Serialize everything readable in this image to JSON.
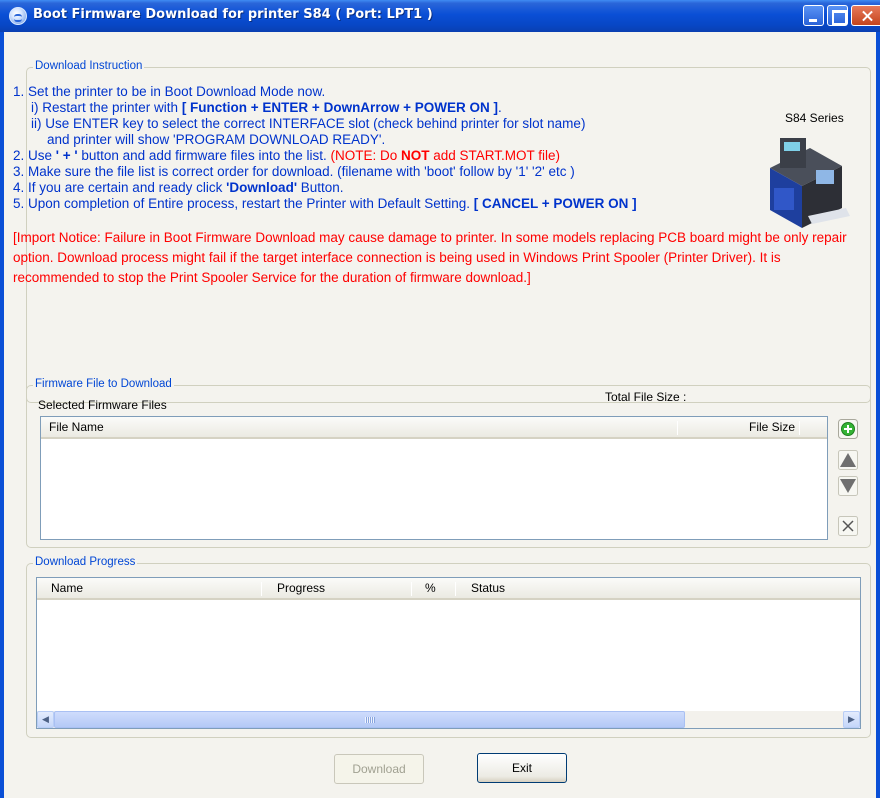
{
  "window": {
    "title": "Boot Firmware Download for printer S84 ( Port: LPT1 )"
  },
  "instruction_group": {
    "title": "Download Instruction",
    "printer_label": "S84 Series",
    "lines": {
      "l1": "1. Set the printer to be in Boot Download Mode now.",
      "l2a": "i)  Restart the printer with ",
      "l2b": "[ Function +  ENTER + DownArrow + POWER ON ]",
      "l2c": ".",
      "l3": "ii) Use ENTER key to select the correct INTERFACE slot (check behind printer for slot name)",
      "l4": "and printer will show 'PROGRAM DOWNLOAD READY'.",
      "l5a": "2. Use ",
      "l5b": "' + '",
      "l5c": " button and add firmware files into the list. ",
      "l5d": "(NOTE: Do ",
      "l5e": "NOT",
      "l5f": " add START.MOT file)",
      "l6": "3. Make sure the file list is correct order for download. (filename with 'boot' follow by '1' '2' etc )",
      "l7a": "4. If you are certain and ready click ",
      "l7b": "'Download'",
      "l7c": " Button.",
      "l8a": "5. Upon completion of Entire process, restart the Printer with Default Setting. ",
      "l8b": "[ CANCEL + POWER ON ]"
    },
    "notice": "[Import Notice: Failure in Boot Firmware Download may cause damage to printer. In some models replacing PCB board might be only repair option. Download process might fail if the target interface connection is being used in Windows Print Spooler (Printer Driver). It is recommended to stop the Print Spooler Service for the duration of firmware download.]"
  },
  "firmware_group": {
    "title": "Firmware File to Download",
    "selected_label": "Selected Firmware Files",
    "total_label": "Total File Size :",
    "columns": [
      "File Name",
      "File Size"
    ],
    "rows": []
  },
  "progress_group": {
    "title": "Download Progress",
    "columns": [
      "Name",
      "Progress",
      "%",
      "Status"
    ],
    "rows": []
  },
  "buttons": {
    "download": "Download",
    "exit": "Exit"
  },
  "icons": {
    "add": "add-file-icon",
    "up": "move-up-icon",
    "down": "move-down-icon",
    "remove": "remove-file-icon"
  },
  "colors": {
    "instruction_text": "#0033cc",
    "warning_text": "#ff0000",
    "group_title": "#0046d5",
    "titlebar": "#0a4fd6"
  }
}
